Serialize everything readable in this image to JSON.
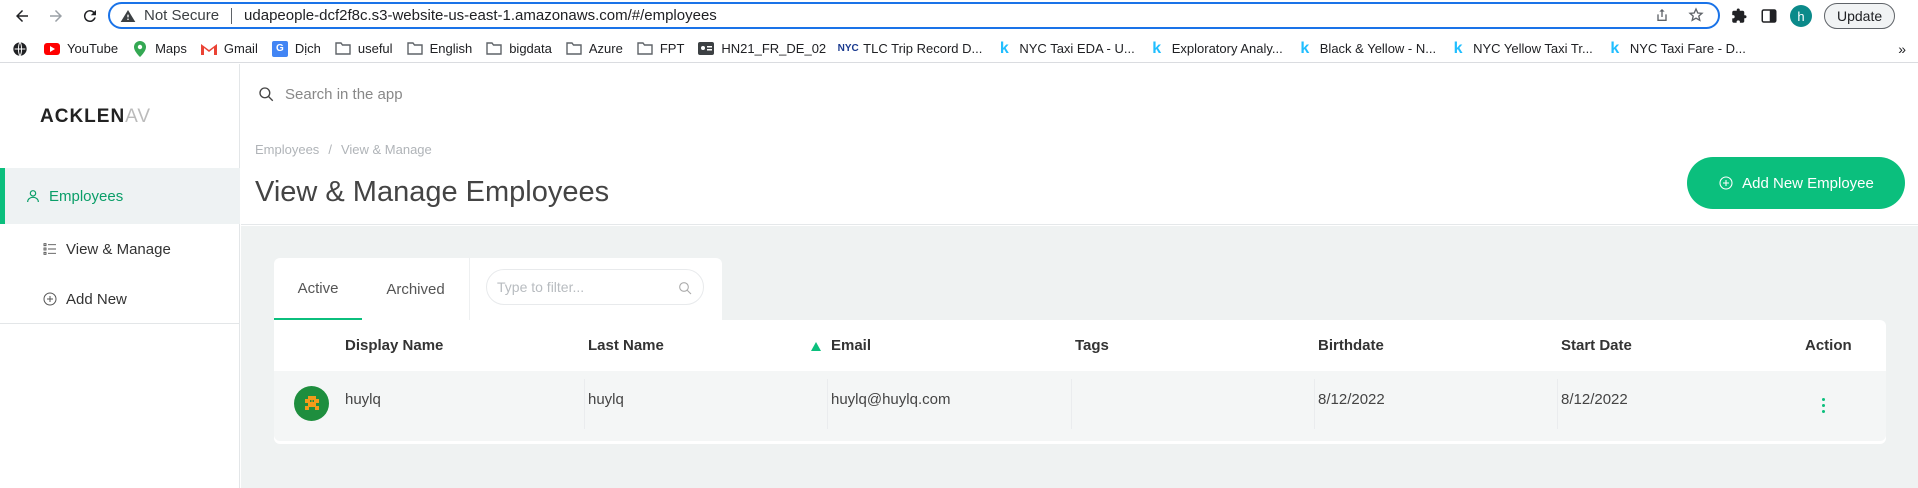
{
  "browser": {
    "security_label": "Not Secure",
    "url": "udapeople-dcf2f8c.s3-website-us-east-1.amazonaws.com/#/employees",
    "profile_initial": "h",
    "update_label": "Update"
  },
  "bookmarks": [
    {
      "label": "YouTube",
      "icon": "youtube-icon",
      "color": "#ff0000"
    },
    {
      "label": "Maps",
      "icon": "maps-icon",
      "color": "#34a853"
    },
    {
      "label": "Gmail",
      "icon": "gmail-icon",
      "color": "#ea4335"
    },
    {
      "label": "Dịch",
      "icon": "translate-icon",
      "color": "#4285f4"
    },
    {
      "label": "useful",
      "icon": "folder-icon"
    },
    {
      "label": "English",
      "icon": "folder-icon"
    },
    {
      "label": "bigdata",
      "icon": "folder-icon"
    },
    {
      "label": "Azure",
      "icon": "folder-icon"
    },
    {
      "label": "FPT",
      "icon": "folder-icon"
    },
    {
      "label": "HN21_FR_DE_02",
      "icon": "id-card-icon"
    },
    {
      "label": "TLC Trip Record D...",
      "icon": "nyc-icon",
      "color": "#1a3a8f"
    },
    {
      "label": "NYC Taxi EDA - U...",
      "icon": "kaggle-icon",
      "color": "#20beff"
    },
    {
      "label": "Exploratory Analy...",
      "icon": "kaggle-icon",
      "color": "#20beff"
    },
    {
      "label": "Black & Yellow - N...",
      "icon": "kaggle-icon",
      "color": "#20beff"
    },
    {
      "label": "NYC Yellow Taxi Tr...",
      "icon": "kaggle-icon",
      "color": "#20beff"
    },
    {
      "label": "NYC Taxi Fare - D...",
      "icon": "kaggle-icon",
      "color": "#20beff"
    }
  ],
  "more_bookmarks": "»",
  "app": {
    "logo_main": "ACKLEN",
    "logo_fade": "AV",
    "search_placeholder": "Search in the app",
    "sidebar": [
      {
        "label": "Employees",
        "icon": "user-icon",
        "active": true
      },
      {
        "label": "View & Manage",
        "icon": "list-icon",
        "active": false
      },
      {
        "label": "Add New",
        "icon": "plus-circle-icon",
        "active": false
      }
    ],
    "breadcrumb": [
      "Employees",
      "View & Manage"
    ],
    "breadcrumb_sep": "/",
    "page_title": "View & Manage Employees",
    "add_button": "Add New Employee",
    "accent": "#0bbf7d",
    "tabs": [
      "Active",
      "Archived"
    ],
    "filter_placeholder": "Type to filter...",
    "table": {
      "columns": [
        "Display Name",
        "Last Name",
        "Email",
        "Tags",
        "Birthdate",
        "Start Date",
        "Action"
      ],
      "rows": [
        {
          "display_name": "huylq",
          "last_name": "huylq",
          "email": "huylq@huylq.com",
          "tags": "",
          "birthdate": "8/12/2022",
          "start_date": "8/12/2022"
        }
      ]
    }
  }
}
